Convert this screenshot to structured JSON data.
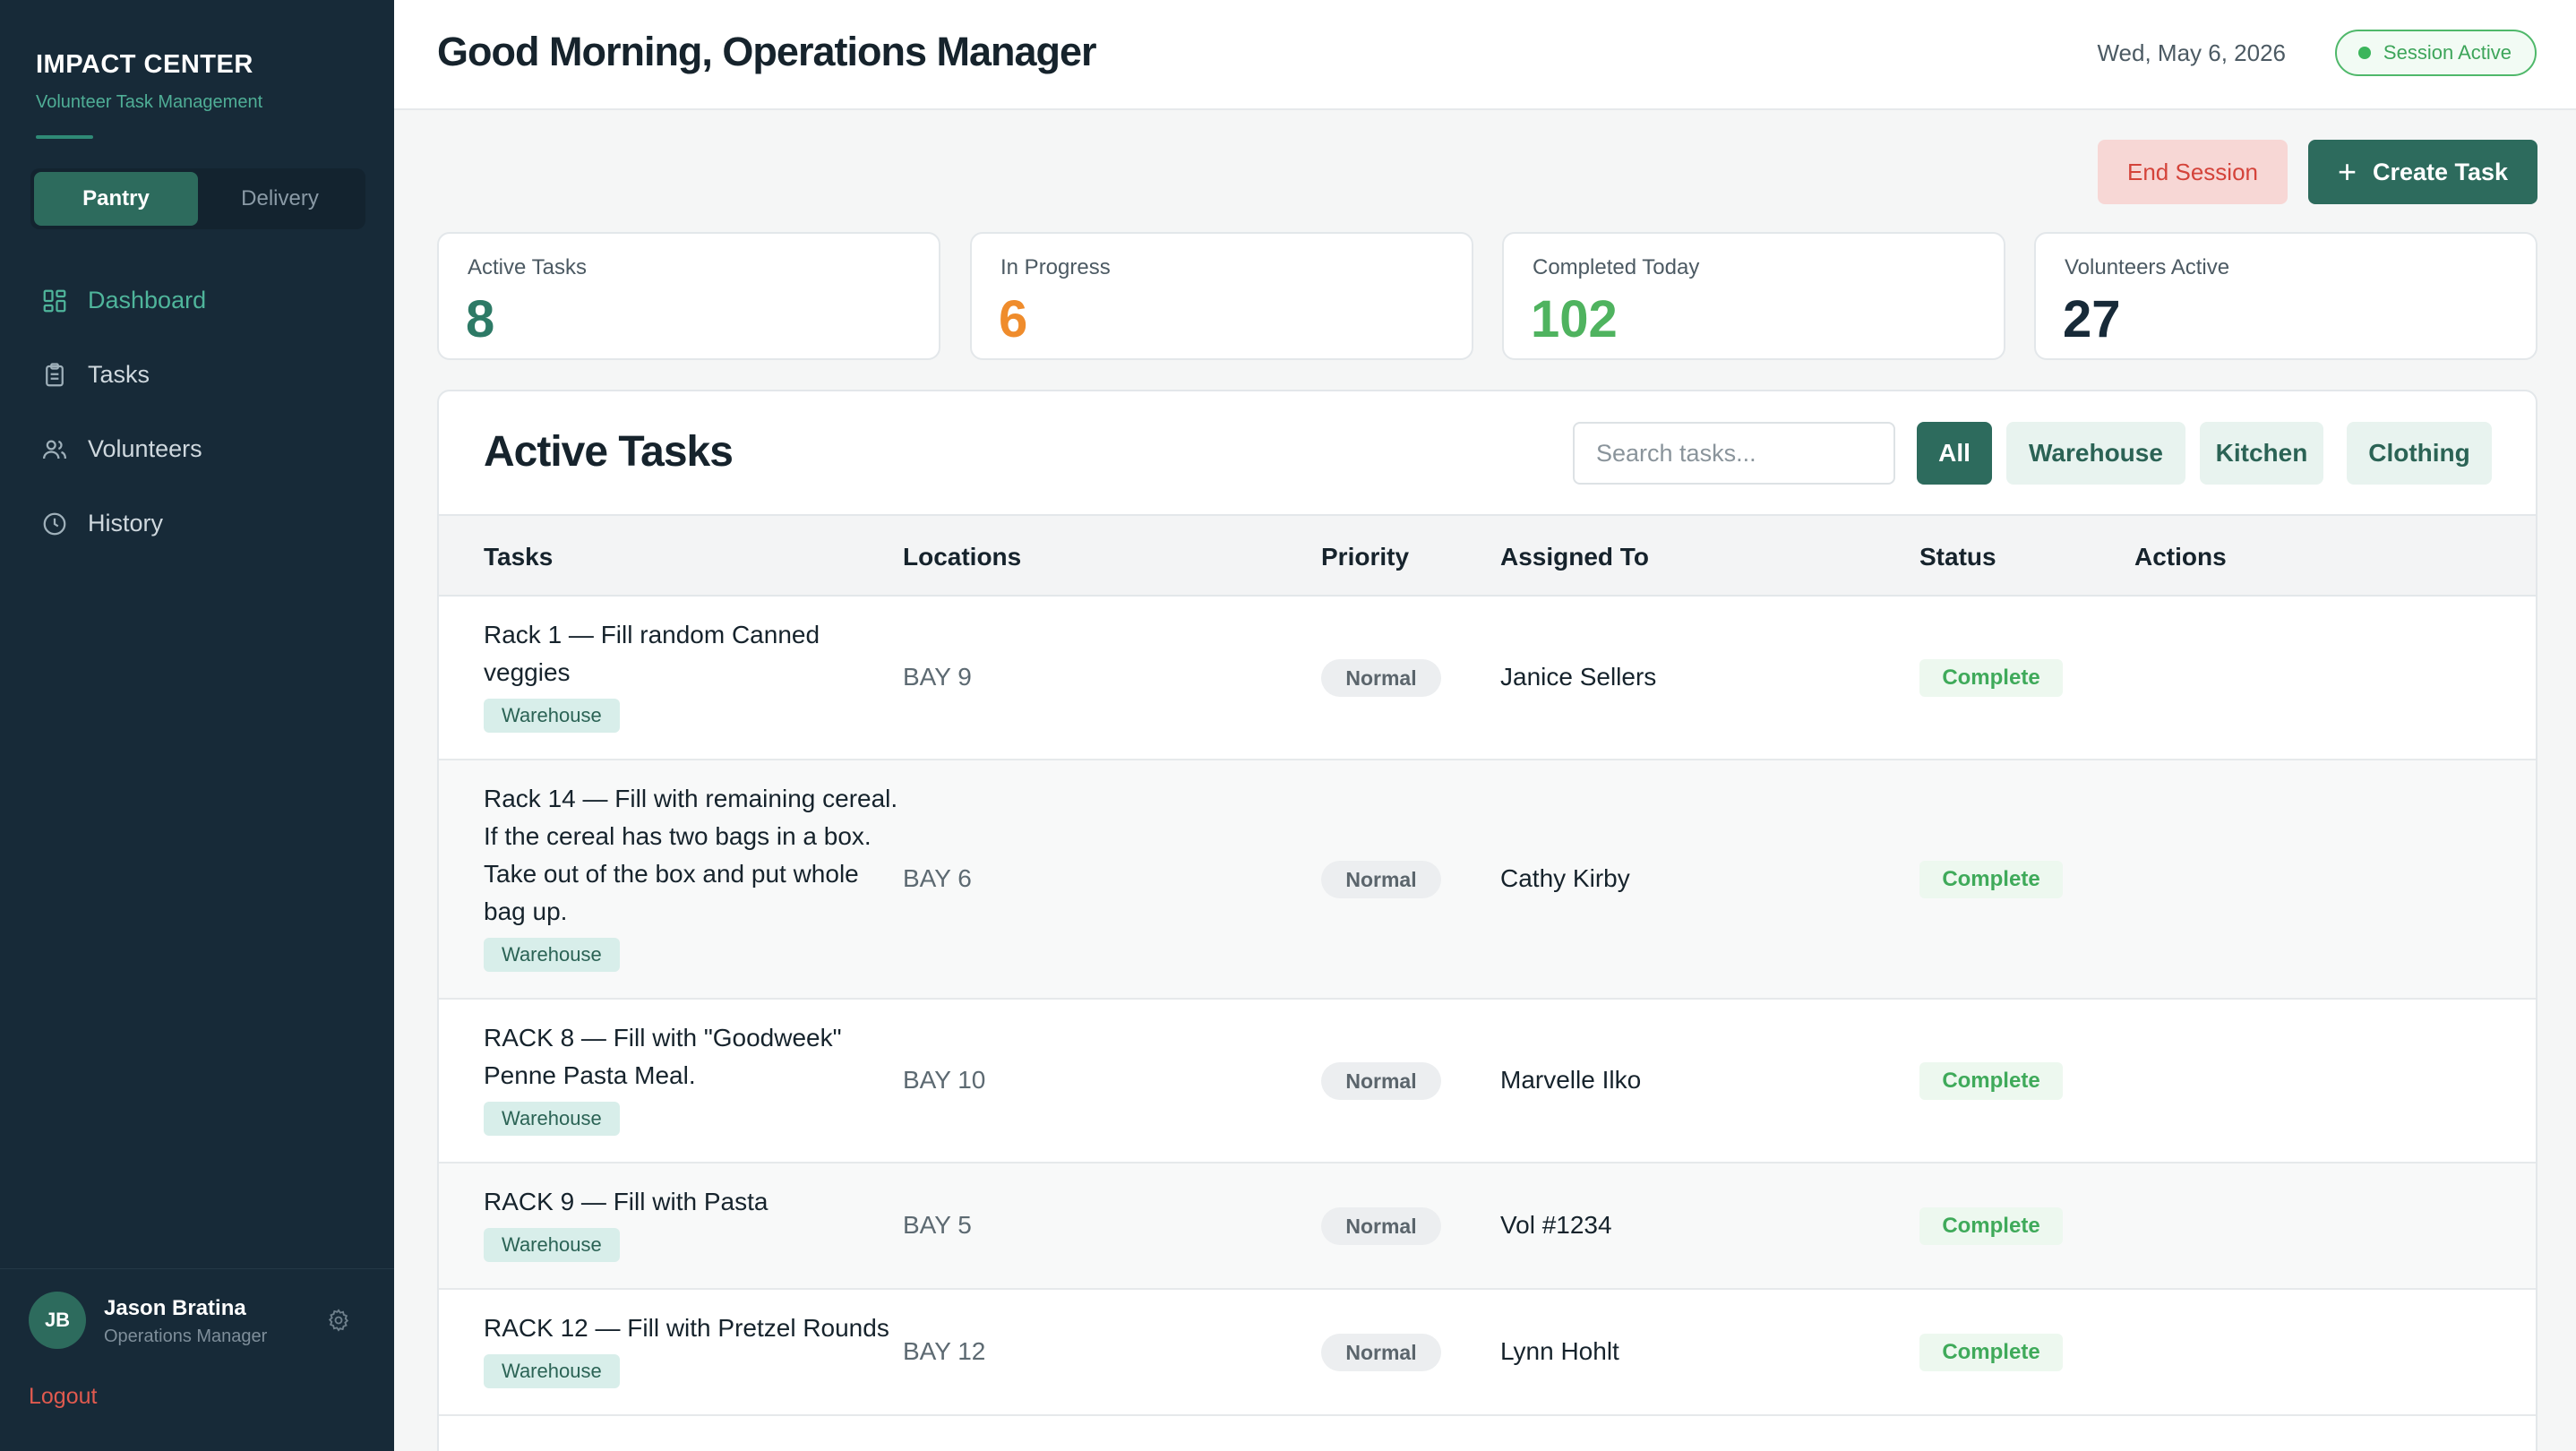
{
  "sidebar": {
    "brand_title": "IMPACT CENTER",
    "brand_subtitle": "Volunteer Task Management",
    "modes": [
      {
        "label": "Pantry",
        "active": true
      },
      {
        "label": "Delivery",
        "active": false
      }
    ],
    "nav": [
      {
        "label": "Dashboard",
        "icon": "grid-icon",
        "active": true
      },
      {
        "label": "Tasks",
        "icon": "clipboard-icon",
        "active": false
      },
      {
        "label": "Volunteers",
        "icon": "users-icon",
        "active": false
      },
      {
        "label": "History",
        "icon": "clock-icon",
        "active": false
      }
    ],
    "user": {
      "initials": "JB",
      "name": "Jason Bratina",
      "role": "Operations Manager"
    },
    "logout_label": "Logout"
  },
  "header": {
    "greeting": "Good Morning, Operations Manager",
    "date": "Wed, May 6, 2026",
    "session_status": "Session Active"
  },
  "actions": {
    "end_session": "End Session",
    "create_task": "Create Task"
  },
  "stats": [
    {
      "label": "Active Tasks",
      "value": "8",
      "color": "#2d7a66"
    },
    {
      "label": "In Progress",
      "value": "6",
      "color": "#ef8c2c"
    },
    {
      "label": "Completed Today",
      "value": "102",
      "color": "#4fb35f"
    },
    {
      "label": "Volunteers Active",
      "value": "27",
      "color": "#172a38"
    }
  ],
  "tasks_panel": {
    "title": "Active Tasks",
    "search_placeholder": "Search tasks...",
    "filters": [
      {
        "label": "All",
        "active": true
      },
      {
        "label": "Warehouse",
        "active": false
      },
      {
        "label": "Kitchen",
        "active": false
      },
      {
        "label": "Clothing",
        "active": false
      }
    ],
    "columns": [
      "Tasks",
      "Locations",
      "Priority",
      "Assigned To",
      "Status",
      "Actions"
    ],
    "rows": [
      {
        "task": "Rack 1 — Fill random Canned veggies",
        "category": "Warehouse",
        "location": "BAY 9",
        "priority": "Normal",
        "assigned": "Janice Sellers",
        "status": "Complete"
      },
      {
        "task": "Rack 14 — Fill with remaining cereal. If the cereal has two bags in a box. Take out of the box and put whole bag up.",
        "category": "Warehouse",
        "location": "BAY 6",
        "priority": "Normal",
        "assigned": "Cathy Kirby",
        "status": "Complete"
      },
      {
        "task": "RACK 8 — Fill with \"Goodweek\" Penne Pasta Meal.",
        "category": "Warehouse",
        "location": "BAY 10",
        "priority": "Normal",
        "assigned": "Marvelle Ilko",
        "status": "Complete"
      },
      {
        "task": "RACK 9 — Fill with Pasta",
        "category": "Warehouse",
        "location": "BAY 5",
        "priority": "Normal",
        "assigned": "Vol #1234",
        "status": "Complete"
      },
      {
        "task": "RACK 12 — Fill with Pretzel Rounds",
        "category": "Warehouse",
        "location": "BAY 12",
        "priority": "Normal",
        "assigned": "Lynn Hohlt",
        "status": "Complete"
      }
    ]
  },
  "colors": {
    "sidebar_bg": "#172a38",
    "accent": "#2d6b5d",
    "status_green": "#3faa5a",
    "danger": "#d4433a"
  }
}
